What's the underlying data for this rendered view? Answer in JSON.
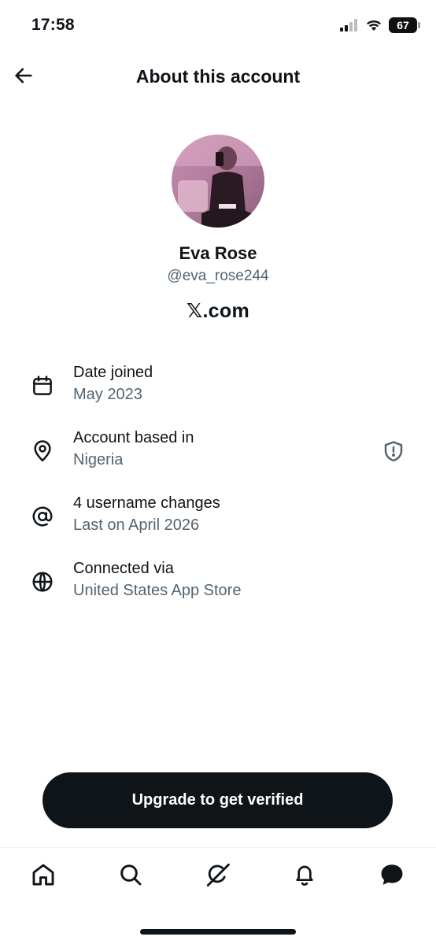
{
  "status_bar": {
    "time": "17:58",
    "battery": "67",
    "icons": [
      "signal-icon",
      "wifi-icon",
      "battery-icon"
    ]
  },
  "header": {
    "title": "About this account",
    "back_icon": "arrow-left-icon"
  },
  "profile": {
    "display_name": "Eva Rose",
    "handle": "@eva_rose244",
    "site": "𝕏.com"
  },
  "info": {
    "date_joined": {
      "title": "Date joined",
      "value": "May 2023",
      "icon": "calendar-icon"
    },
    "based_in": {
      "title": "Account based in",
      "value": "Nigeria",
      "icon": "location-pin-icon",
      "action_icon": "shield-exclamation-icon"
    },
    "username_changes": {
      "title": "4 username changes",
      "value": "Last on April 2026",
      "icon": "at-sign-icon"
    },
    "connected_via": {
      "title": "Connected via",
      "value": "United States App Store",
      "icon": "globe-icon"
    }
  },
  "cta": {
    "label": "Upgrade to get verified"
  },
  "bottom_nav": {
    "items": [
      "home-icon",
      "search-icon",
      "grok-icon",
      "notifications-icon",
      "messages-icon"
    ]
  },
  "colors": {
    "primary_text": "#0f1419",
    "secondary_text": "#536471",
    "button_bg": "#0f1419"
  }
}
